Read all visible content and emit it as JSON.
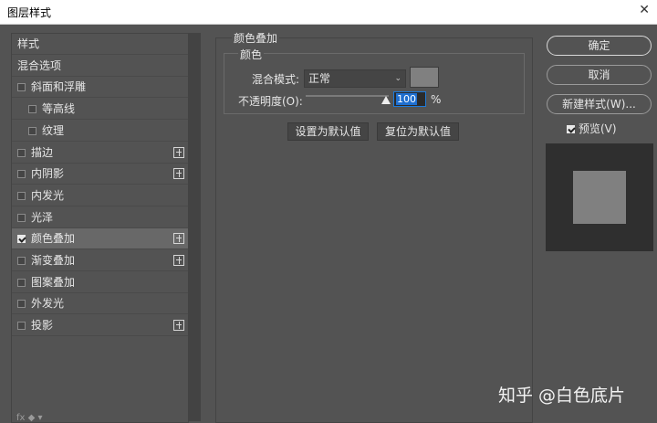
{
  "window": {
    "title": "图层样式",
    "close_glyph": "✕"
  },
  "sidebar": {
    "items": [
      {
        "label": "样式",
        "checkbox": false,
        "checked": false,
        "plus": false,
        "indent": 0
      },
      {
        "label": "混合选项",
        "checkbox": false,
        "checked": false,
        "plus": false,
        "indent": 0
      },
      {
        "label": "斜面和浮雕",
        "checkbox": true,
        "checked": false,
        "plus": false,
        "indent": 0
      },
      {
        "label": "等高线",
        "checkbox": true,
        "checked": false,
        "plus": false,
        "indent": 1
      },
      {
        "label": "纹理",
        "checkbox": true,
        "checked": false,
        "plus": false,
        "indent": 1
      },
      {
        "label": "描边",
        "checkbox": true,
        "checked": false,
        "plus": true,
        "indent": 0
      },
      {
        "label": "内阴影",
        "checkbox": true,
        "checked": false,
        "plus": true,
        "indent": 0
      },
      {
        "label": "内发光",
        "checkbox": true,
        "checked": false,
        "plus": false,
        "indent": 0
      },
      {
        "label": "光泽",
        "checkbox": true,
        "checked": false,
        "plus": false,
        "indent": 0
      },
      {
        "label": "颜色叠加",
        "checkbox": true,
        "checked": true,
        "plus": true,
        "indent": 0,
        "selected": true
      },
      {
        "label": "渐变叠加",
        "checkbox": true,
        "checked": false,
        "plus": true,
        "indent": 0
      },
      {
        "label": "图案叠加",
        "checkbox": true,
        "checked": false,
        "plus": false,
        "indent": 0
      },
      {
        "label": "外发光",
        "checkbox": true,
        "checked": false,
        "plus": false,
        "indent": 0
      },
      {
        "label": "投影",
        "checkbox": true,
        "checked": false,
        "plus": true,
        "indent": 0
      }
    ],
    "footer": "fx  ◆  ▾"
  },
  "overlay": {
    "group_title": "颜色叠加",
    "subgroup_title": "颜色",
    "blend_mode_label": "混合模式:",
    "blend_mode_value": "正常",
    "overlay_color": "#808080",
    "opacity_label": "不透明度(O):",
    "opacity_value": "100",
    "opacity_unit": "%",
    "opacity_percent": 100,
    "set_default_label": "设置为默认值",
    "reset_default_label": "复位为默认值"
  },
  "actions": {
    "ok_label": "确定",
    "cancel_label": "取消",
    "new_style_label": "新建样式(W)...",
    "preview_label": "预览(V)",
    "preview_checked": true
  },
  "watermark": "知乎 @白色底片"
}
